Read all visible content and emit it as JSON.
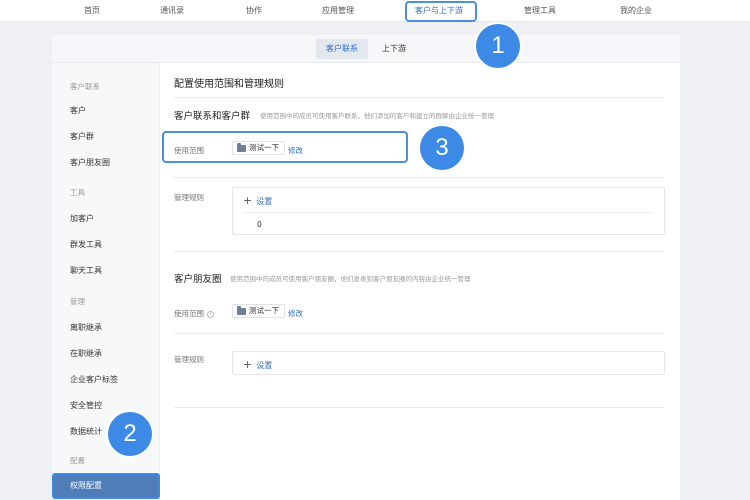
{
  "topnav": {
    "items": [
      "首页",
      "通讯录",
      "协作",
      "应用管理",
      "客户与上下游",
      "管理工具",
      "我的企业"
    ]
  },
  "subtabs": [
    "客户联系",
    "上下游"
  ],
  "sidebar": {
    "group1": "客户联系",
    "g1_items": [
      "客户",
      "客户群",
      "客户朋友圈"
    ],
    "group2": "工具",
    "g2_items": [
      "加客户",
      "群发工具",
      "聊天工具"
    ],
    "group3": "管理",
    "g3_items": [
      "离职继承",
      "在职继承",
      "企业客户标签",
      "安全管控",
      "数据统计"
    ],
    "group4": "配置",
    "active_item": "权限配置"
  },
  "content": {
    "title": "配置使用范围和管理规则",
    "sec1": {
      "title": "客户联系和客户群",
      "desc": "使用范围中的成员可使用客户联系，他们添加的客户和建立的群聊由企业统一管理",
      "scope_label": "使用范围",
      "scope_value": "测试一下",
      "edit": "修改",
      "rules_label": "管理规则",
      "add_label": "设置",
      "count": "0"
    },
    "sec2": {
      "title": "客户朋友圈",
      "desc": "使用范围中的成员可使用客户朋友圈，他们发表到客户朋友圈的内容由企业统一管理",
      "scope_label": "使用范围",
      "scope_value": "测试一下",
      "edit": "修改",
      "rules_label": "管理规则",
      "add_label": "设置"
    }
  },
  "badges": [
    "1",
    "2",
    "3"
  ],
  "colors": {
    "accent": "#2f6fbf",
    "badge": "#3d8ae6",
    "highlight": "#4a8fe0",
    "active_sidebar": "#4e7db8"
  }
}
